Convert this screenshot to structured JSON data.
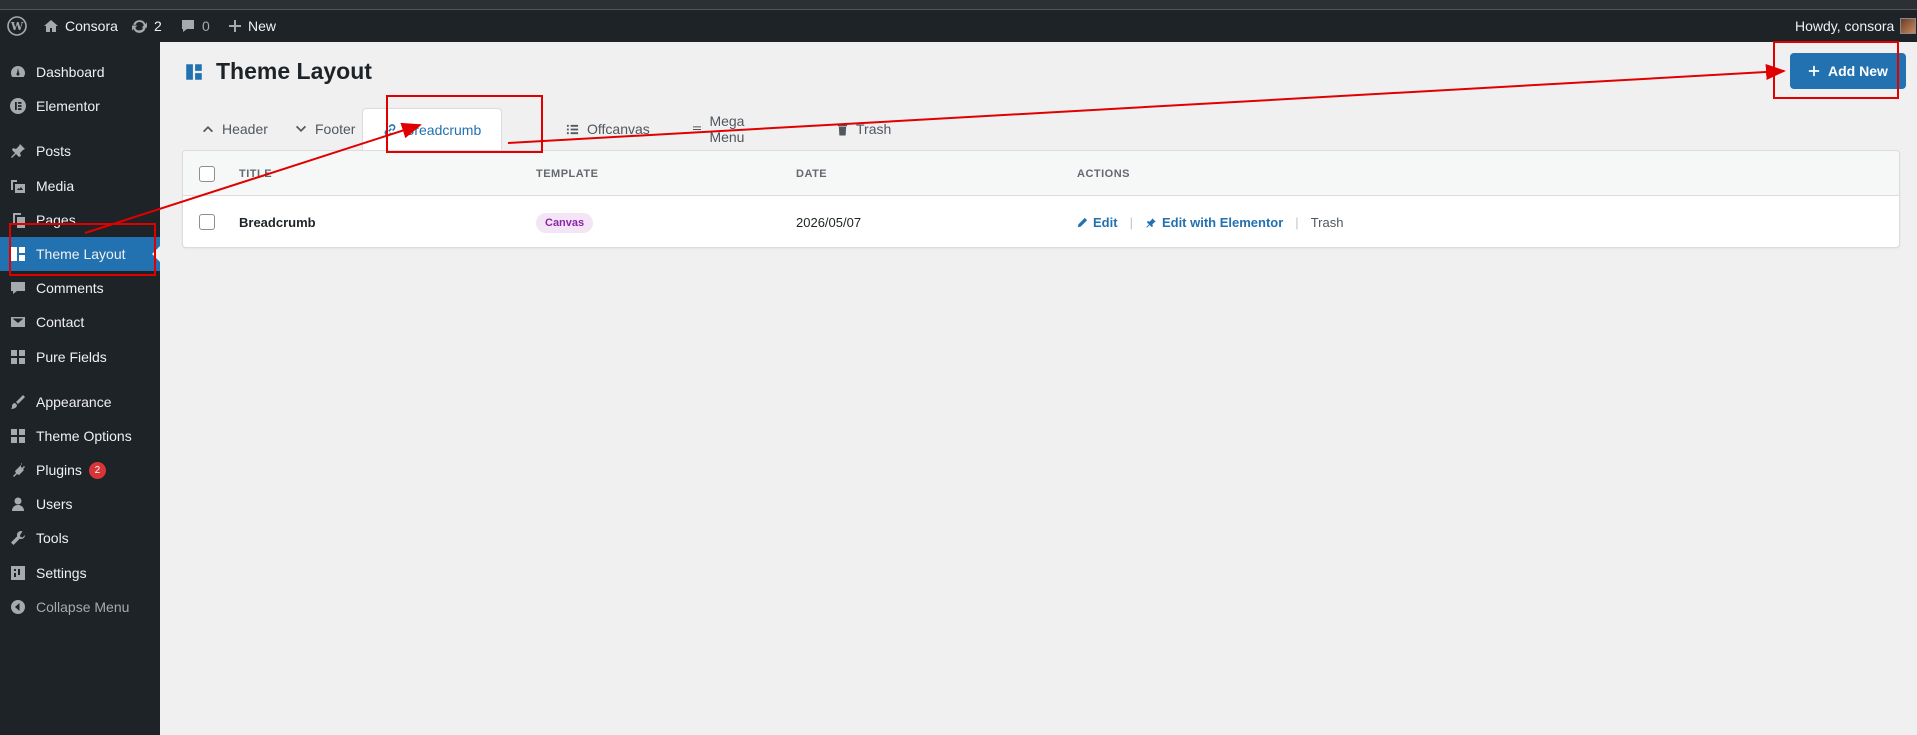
{
  "admin_bar": {
    "site_name": "Consora",
    "updates_count": "2",
    "comments_count": "0",
    "new_label": "New",
    "howdy": "Howdy, consora"
  },
  "sidebar": {
    "items": [
      {
        "label": "Dashboard",
        "icon": "dashboard-icon"
      },
      {
        "label": "Elementor",
        "icon": "elementor-icon"
      },
      {
        "label": "Posts",
        "icon": "pin-icon"
      },
      {
        "label": "Media",
        "icon": "media-icon"
      },
      {
        "label": "Pages",
        "icon": "pages-icon"
      },
      {
        "label": "Theme Layout",
        "icon": "layout-icon"
      },
      {
        "label": "Comments",
        "icon": "comment-icon"
      },
      {
        "label": "Contact",
        "icon": "envelope-icon"
      },
      {
        "label": "Pure Fields",
        "icon": "grid-icon"
      },
      {
        "label": "Appearance",
        "icon": "brush-icon"
      },
      {
        "label": "Theme Options",
        "icon": "grid-icon"
      },
      {
        "label": "Plugins",
        "icon": "plug-icon",
        "badge": "2"
      },
      {
        "label": "Users",
        "icon": "user-icon"
      },
      {
        "label": "Tools",
        "icon": "wrench-icon"
      },
      {
        "label": "Settings",
        "icon": "settings-icon"
      },
      {
        "label": "Collapse Menu",
        "icon": "collapse-icon"
      }
    ],
    "active": "Theme Layout"
  },
  "page": {
    "title": "Theme Layout",
    "add_new_label": "Add New"
  },
  "tabs": [
    {
      "label": "Header",
      "icon": "chevron-up-icon"
    },
    {
      "label": "Footer",
      "icon": "chevron-down-icon"
    },
    {
      "label": "Breadcrumb",
      "icon": "link-icon",
      "active": true
    },
    {
      "label": "Offcanvas",
      "icon": "list-icon"
    },
    {
      "label": "Mega Menu",
      "icon": "menu-icon"
    },
    {
      "label": "Trash",
      "icon": "trash-icon"
    }
  ],
  "table": {
    "columns": [
      "TITLE",
      "TEMPLATE",
      "DATE",
      "ACTIONS"
    ],
    "rows": [
      {
        "title": "Breadcrumb",
        "template": "Canvas",
        "date": "2026/05/07",
        "actions": {
          "edit": "Edit",
          "edit_elementor": "Edit with Elementor",
          "trash": "Trash"
        }
      }
    ]
  },
  "colors": {
    "accent": "#2271b1",
    "admin_bar": "#1d2327",
    "annotation": "#e00000",
    "badge": "#d63638"
  }
}
